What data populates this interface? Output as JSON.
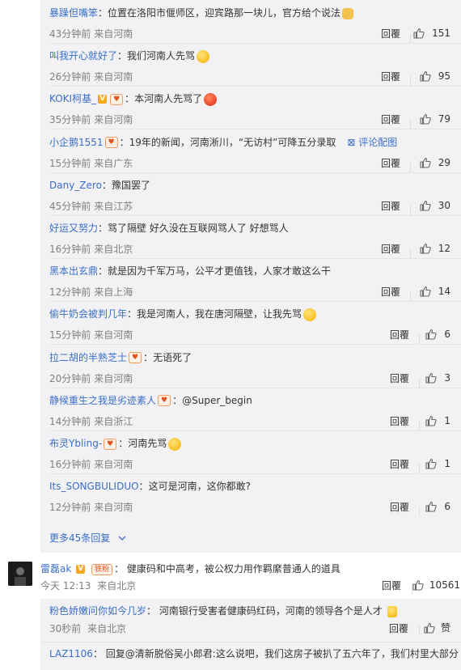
{
  "sub_comments": [
    {
      "user": "暴躁但嘴笨",
      "badges": [],
      "text": "位置在洛阳市偃师区，迎宾路那一块儿，官方给个说法",
      "emoji": "pray",
      "time": "43分钟前",
      "location": "来自河南",
      "reply_label": "回覆",
      "likes": "151"
    },
    {
      "user": "叫我开心就好了",
      "badges": [],
      "text": "我们河南人先骂",
      "emoji": "yellow",
      "time": "26分钟前",
      "location": "来自河南",
      "reply_label": "回覆",
      "likes": "95"
    },
    {
      "user": "KOKI柯基_",
      "badges": [
        "v",
        "fan"
      ],
      "text": "本河南人先骂了",
      "emoji": "red",
      "time": "35分钟前",
      "location": "来自河南",
      "reply_label": "回覆",
      "likes": "79"
    },
    {
      "user": "小企鹅1551",
      "badges": [
        "fan"
      ],
      "text": "19年的新闻，河南淅川，“无访村”可降五分录取",
      "emoji": "",
      "tag_link": "评论配图",
      "time": "15分钟前",
      "location": "来自广东",
      "reply_label": "回覆",
      "likes": "29"
    },
    {
      "user": "Dany_Zero",
      "badges": [],
      "text": "豫国罢了",
      "emoji": "",
      "time": "45分钟前",
      "location": "来自江苏",
      "reply_label": "回覆",
      "likes": "30"
    },
    {
      "user": "好运又努力",
      "badges": [],
      "text": "骂了隔壁 好久没在互联网骂人了 好想骂人",
      "emoji": "",
      "time": "16分钟前",
      "location": "来自北京",
      "reply_label": "回覆",
      "likes": "12"
    },
    {
      "user": "黑本出玄鼎",
      "badges": [],
      "text": "就是因为千军万马，公平才更值钱，人家才敢这么干",
      "emoji": "",
      "time": "12分钟前",
      "location": "来自上海",
      "reply_label": "回覆",
      "likes": "14"
    },
    {
      "user": "偷牛奶会被判几年",
      "badges": [],
      "text": "我是河南人，我在唐河隔壁，让我先骂",
      "emoji": "yellow",
      "time": "15分钟前",
      "location": "来自河南",
      "reply_label": "回覆",
      "likes": "6"
    },
    {
      "user": "拉二胡的半熟芝士",
      "badges": [
        "fan"
      ],
      "text": "无语死了",
      "emoji": "",
      "time": "20分钟前",
      "location": "来自河南",
      "reply_label": "回覆",
      "likes": "3"
    },
    {
      "user": "静候重生之我是劣迹素人",
      "badges": [
        "fan"
      ],
      "text": "@Super_begin",
      "emoji": "",
      "time": "14分钟前",
      "location": "来自浙江",
      "reply_label": "回覆",
      "likes": "1"
    },
    {
      "user": "布灵Ybling-",
      "badges": [
        "fan"
      ],
      "text": "河南先骂",
      "emoji": "yellow",
      "time": "16分钟前",
      "location": "来自河南",
      "reply_label": "回覆",
      "likes": "1"
    },
    {
      "user": "Its_SONGBULIDUO",
      "badges": [],
      "text": "这可是河南，这你都敢?",
      "emoji": "",
      "time": "12分钟前",
      "location": "来自河南",
      "reply_label": "回覆",
      "likes": "6"
    }
  ],
  "more_replies": "更多45条回复",
  "main_comment": {
    "user": "雷磊ak",
    "fan_badge": "铁粉",
    "text": "健康码和中高考，被公权力用作羁縻普通人的道具",
    "time": "今天 12:13",
    "location": "来自北京",
    "reply_label": "回覆",
    "likes": "10561"
  },
  "main_replies": [
    {
      "user": "粉色娇嫩问你如今几岁",
      "text": "河南银行受害者健康码红码，河南的领导各个是人才",
      "time": "30秒前",
      "location": "来自北京",
      "reply_label": "回覆",
      "likes": "赞"
    },
    {
      "user": "LAZ1106",
      "text": "回复@清新脱俗吴小郎君:这么说吧，我们这房子被扒了五六年了，我们村里大部分"
    }
  ],
  "colors": {
    "link": "#3a6ec8",
    "meta": "#808080",
    "sub_bg": "#f2f2f5"
  }
}
